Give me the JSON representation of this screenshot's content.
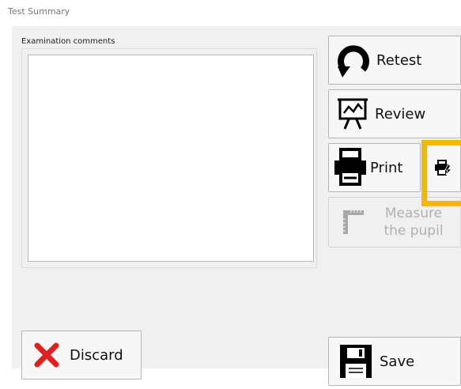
{
  "window": {
    "title": "Test Summary"
  },
  "comments": {
    "label": "Examination comments",
    "value": ""
  },
  "actions": {
    "retest_label": "Retest",
    "review_label": "Review",
    "print_label": "Print",
    "measure_label": "Measure the pupil",
    "measure_enabled": false
  },
  "footer": {
    "discard_label": "Discard",
    "save_label": "Save"
  },
  "icons": {
    "retest": "circular-arrow-icon",
    "review": "presentation-board-icon",
    "print": "printer-icon",
    "quick_print": "quick-print-icon",
    "measure": "ruler-icon",
    "discard": "red-x-icon",
    "save": "floppy-disk-icon"
  },
  "colors": {
    "highlight": "#f5b800",
    "discard_x": "#e02020",
    "disabled_text": "#b0b0b0"
  }
}
